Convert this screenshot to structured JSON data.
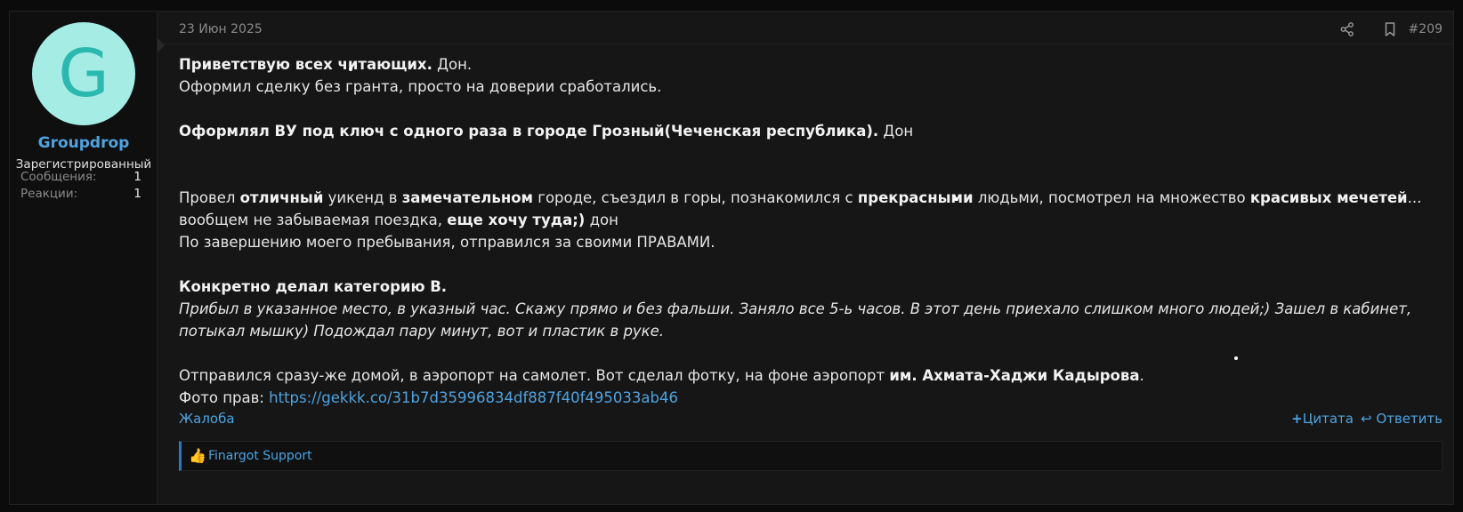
{
  "user": {
    "avatar_letter": "G",
    "name": "Groupdrop",
    "title": "Зарегистрированный",
    "stats": [
      {
        "label": "Сообщения:",
        "value": "1"
      },
      {
        "label": "Реакции:",
        "value": "1"
      }
    ]
  },
  "post": {
    "date": "23 Июн 2025",
    "number": "#209",
    "line1_bold": "Приветствую всех читающих.",
    "line1_rest": " Дон.",
    "line2": "Оформил сделку без гранта, просто на доверии сработались.",
    "line3_bold": "Оформлял ВУ под ключ с одного раза в городе Грозный(Чеченская республика).",
    "line3_rest": " Дон",
    "p4": {
      "t1": "Провел ",
      "b1": "отличный",
      "t2": " уикенд в ",
      "b2": "замечательном",
      "t3": " городе, съездил в горы, познакомился с ",
      "b3": "прекрасными",
      "t4": " людьми, посмотрел на множество ",
      "b4": "красивых мечетей",
      "t5": "... вообщем не забываемая поездка, ",
      "b5": "еще хочу туда;)",
      "t6": " дон"
    },
    "line5": "По завершению моего пребывания, отправился за своими ПРАВАМИ.",
    "line6_bold": "Конкретно делал категорию В.",
    "line7_italic": "Прибыл в указанное место, в указный час. Скажу прямо и без фальши. Заняло все 5-ь часов. В этот день приехало слишком много людей;) Зашел в кабинет, потыкал мышку) Подождал пару минут, вот и пластик в руке.",
    "line8_text": "Отправился сразу-же домой, в аэропорт на самолет. Вот сделал фотку, на фоне аэропорт ",
    "line8_bold": "им. Ахмата-Хаджи Кадырова",
    "line8_end": ".",
    "line9_label": "Фото прав: ",
    "line9_link": "https://gekkk.co/31b7d35996834df887f40f495033ab46"
  },
  "actions": {
    "report": "Жалоба",
    "quote": "Цитата",
    "reply": "Ответить"
  },
  "reactions": {
    "icon": "thumbs-up-icon",
    "names": "Finargot Support"
  },
  "colors": {
    "accent": "#4fa3e0",
    "avatar_bg": "#a5ece5",
    "avatar_fg": "#2bb8ae",
    "background": "#161616"
  }
}
